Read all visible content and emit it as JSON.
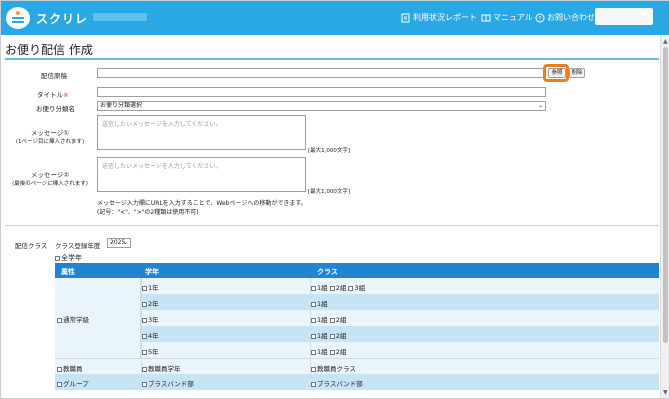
{
  "header": {
    "app_title": "スクリレ",
    "usage_report": "利用状況レポート",
    "manual": "マニュアル",
    "contact": "お問い合わせ",
    "icons": [
      "report-icon",
      "book-icon",
      "question-icon"
    ]
  },
  "page": {
    "title": "お便り配信 作成"
  },
  "form": {
    "attachment_label": "配信原稿",
    "browse_label": "参照",
    "clear_label": "削除",
    "title_label": "タイトル",
    "required_mark": "※",
    "category_label": "お便り分類名",
    "category_value": "お便り分類選択",
    "msg1_label": "メッセージ①",
    "msg1_sub": "(1ページ目に挿入されます)",
    "msg1_placeholder": "送信したいメッセージを入力してください。",
    "msg2_label": "メッセージ②",
    "msg2_sub": "(最後のページに挿入されます)",
    "msg2_placeholder": "送信したいメッセージを入力してください。",
    "max_chars": "[最大1,000文字]",
    "note1": "メッセージ入力欄にURLを入力することで、Webページへの移動ができます。",
    "note2": "(記号：\"<\"、\">\"の2種類は使用不可)"
  },
  "class_section": {
    "label": "配信クラス",
    "year_label": "クラス登録年度",
    "year_value": "2025",
    "all_grades": "全学年"
  },
  "table": {
    "headers": [
      "属性",
      "学年",
      "クラス"
    ],
    "regular_attr": "通常学級",
    "regular_rows": [
      {
        "grade": "1年",
        "classes": [
          "1組",
          "2組",
          "3組"
        ]
      },
      {
        "grade": "2年",
        "classes": [
          "1組"
        ]
      },
      {
        "grade": "3年",
        "classes": [
          "1組",
          "2組"
        ]
      },
      {
        "grade": "4年",
        "classes": [
          "1組",
          "2組"
        ]
      },
      {
        "grade": "5年",
        "classes": [
          "1組",
          "2組"
        ]
      }
    ],
    "staff_row": {
      "attr": "教職員",
      "grade": "教職員学年",
      "cls": "教職員クラス"
    },
    "group_row": {
      "attr": "グループ",
      "grade": "ブラスバンド部",
      "cls": "ブラスバンド部"
    }
  },
  "colors": {
    "header": "#2aa8e4",
    "table_head": "#1f84d4",
    "highlight": "#f07c1d"
  }
}
